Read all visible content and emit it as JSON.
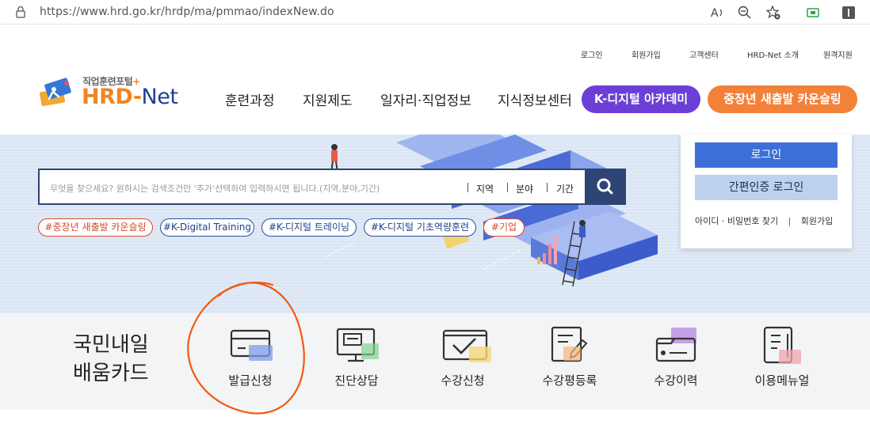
{
  "browser": {
    "url": "https://www.hrd.go.kr/hrdp/ma/pmmao/indexNew.do"
  },
  "utility_links": [
    "로그인",
    "회원가입",
    "고객센터",
    "HRD-Net 소개",
    "원격지원"
  ],
  "logo": {
    "subtitle": "직업훈련포털",
    "plus": "+",
    "name_hrd": "HRD",
    "name_dash": "-",
    "name_net": "Net"
  },
  "nav": {
    "items": [
      "훈련과정",
      "지원제도",
      "일자리·직업정보",
      "지식정보센터"
    ],
    "digital_academy": "K-디지털 아카데미",
    "counseling": "중장년 새출발 카운슬링"
  },
  "search": {
    "placeholder": "무엇을 찾으세요? 원하시는 검색조건만 '추가'선택하여 입력하시면 됩니다.(지역,분야,기간)",
    "filters": [
      "지역",
      "분야",
      "기간"
    ]
  },
  "tags": [
    "#중장년 새출발 카운슬링",
    "#K-Digital Training",
    "#K-디지털 트레이닝",
    "#K-디지털 기초역량훈련",
    "#기업"
  ],
  "login": {
    "login_button": "로그인",
    "simple_login_button": "간편인증 로그인",
    "find_link": "아이디 · 비밀번호 찾기",
    "divider": "|",
    "signup_link": "회원가입"
  },
  "card_section": {
    "title_line1": "국민내일",
    "title_line2": "배움카드",
    "items": [
      {
        "label": "발급신청",
        "icon": "card-icon"
      },
      {
        "label": "진단상담",
        "icon": "monitor-chat-icon"
      },
      {
        "label": "수강신청",
        "icon": "checkbox-icon"
      },
      {
        "label": "수강평등록",
        "icon": "review-edit-icon"
      },
      {
        "label": "수강이력",
        "icon": "folder-history-icon"
      },
      {
        "label": "이용메뉴얼",
        "icon": "manual-book-icon"
      }
    ]
  },
  "colors": {
    "navy": "#2e4475",
    "accent_orange": "#f3813a",
    "accent_purple": "#6b3fd6",
    "login_blue": "#3d6fd8",
    "annotation": "#f05a10"
  }
}
